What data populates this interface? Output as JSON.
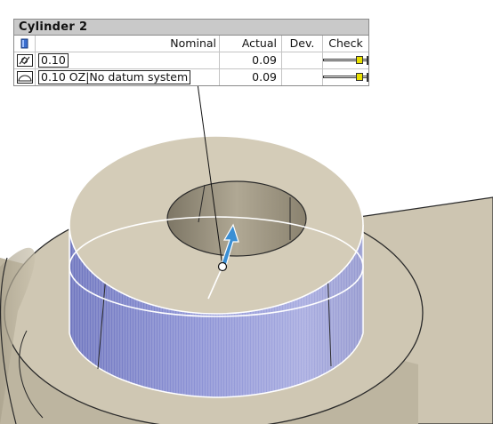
{
  "feature": {
    "title": "Cylinder 2",
    "columns": {
      "nominal": "Nominal",
      "actual": "Actual",
      "deviation": "Dev.",
      "check": "Check"
    },
    "rows": [
      {
        "icon": "cylindricity-icon",
        "nominal": "0.10",
        "actual": "0.09",
        "deviation": "",
        "check_fraction": 0.9
      },
      {
        "icon": "profile-of-surface-icon",
        "nominal": "0.10 OZ|No datum system",
        "actual": "0.09",
        "deviation": "",
        "check_fraction": 0.9
      }
    ]
  },
  "colors": {
    "part_surface": "#cfc7b3",
    "part_shadow": "#a49c88",
    "selected_face": "#7b82c6",
    "axis_arrow": "#3a8fd4",
    "gauge_marker": "#e8e000"
  }
}
